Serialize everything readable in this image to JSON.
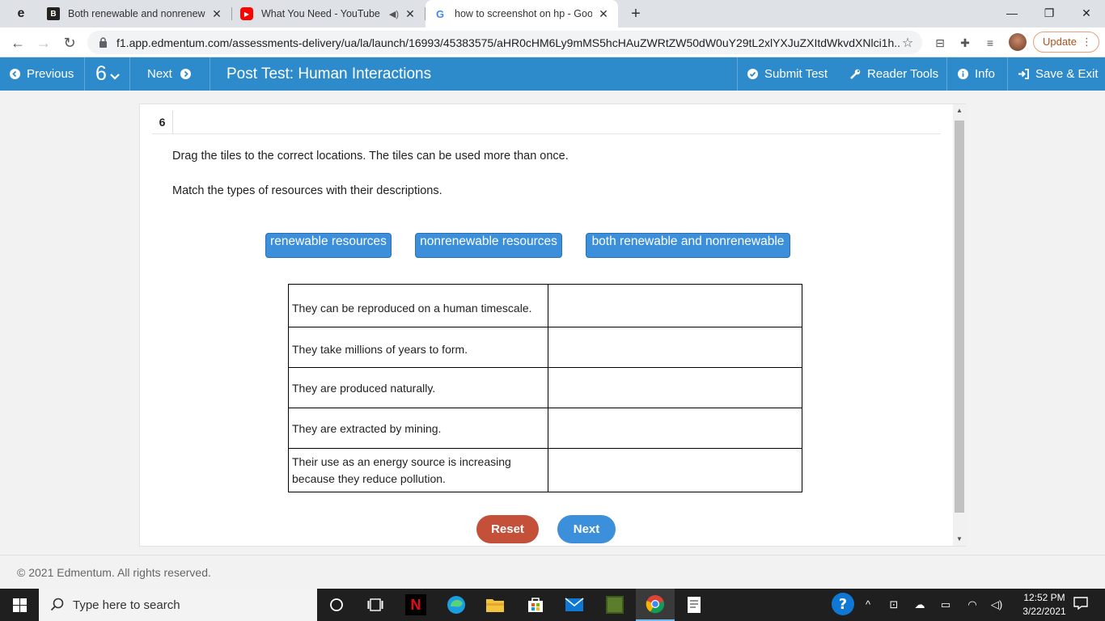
{
  "browser": {
    "profile_letter": "e",
    "tabs": [
      {
        "title": "Both renewable and nonrenewab",
        "favicon": "B"
      },
      {
        "title": "What You Need - YouTube",
        "favicon": "▶"
      },
      {
        "title": "how to screenshot on hp - Goog",
        "favicon": "G"
      }
    ],
    "url": "f1.app.edmentum.com/assessments-delivery/ua/la/launch/16993/45383575/aHR0cHM6Ly9mMS5hcHAuZWRtZW50dW0uY29tL2xlYXJuZXItdWkvdXNlci1h...",
    "update_label": "Update"
  },
  "header": {
    "previous_label": "Previous",
    "question_number": "6",
    "next_label": "Next",
    "title": "Post Test: Human Interactions",
    "submit_label": "Submit Test",
    "reader_tools_label": "Reader Tools",
    "info_label": "Info",
    "save_exit_label": "Save & Exit"
  },
  "question": {
    "number": "6",
    "instruction": "Drag the tiles to the correct locations. The tiles can be used more than once.",
    "prompt": "Match the types of resources with their descriptions.",
    "tiles": [
      "renewable resources",
      "nonrenewable resources",
      "both renewable and nonrenewable"
    ],
    "rows": [
      {
        "description": "They can be reproduced on a human timescale.",
        "answer": ""
      },
      {
        "description": "They take millions of years to form.",
        "answer": ""
      },
      {
        "description": "They are produced naturally.",
        "answer": ""
      },
      {
        "description": "They are extracted by mining.",
        "answer": ""
      },
      {
        "description": "Their use as an energy source is increasing because they reduce pollution.",
        "answer": ""
      }
    ],
    "reset_label": "Reset",
    "next_label": "Next"
  },
  "footer": {
    "copyright": "© 2021 Edmentum. All rights reserved."
  },
  "taskbar": {
    "search_placeholder": "Type here to search",
    "time": "12:52 PM",
    "date": "3/22/2021"
  },
  "colors": {
    "header_blue": "#2d8bcb",
    "tile_blue": "#3b8fdb",
    "reset_red": "#c4503a",
    "update_orange": "#b0501d"
  }
}
